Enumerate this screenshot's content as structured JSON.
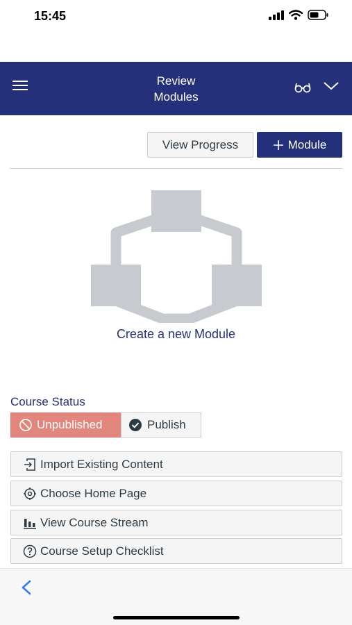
{
  "status_bar": {
    "time": "15:45"
  },
  "header": {
    "title_line1": "Review",
    "title_line2": "Modules"
  },
  "toolbar": {
    "view_progress_label": "View Progress",
    "add_module_label": "Module"
  },
  "empty_state": {
    "create_label": "Create a new Module"
  },
  "course_status": {
    "label": "Course Status",
    "unpublished_label": "Unpublished",
    "publish_label": "Publish",
    "unpublished_color": "#e2857d"
  },
  "actions": [
    {
      "label": "Import Existing Content",
      "icon": "import-icon"
    },
    {
      "label": "Choose Home Page",
      "icon": "target-icon"
    },
    {
      "label": "View Course Stream",
      "icon": "bar-chart-icon"
    },
    {
      "label": "Course Setup Checklist",
      "icon": "help-circle-icon"
    }
  ],
  "colors": {
    "brand": "#24307a",
    "illustration": "#c7cbcf"
  }
}
